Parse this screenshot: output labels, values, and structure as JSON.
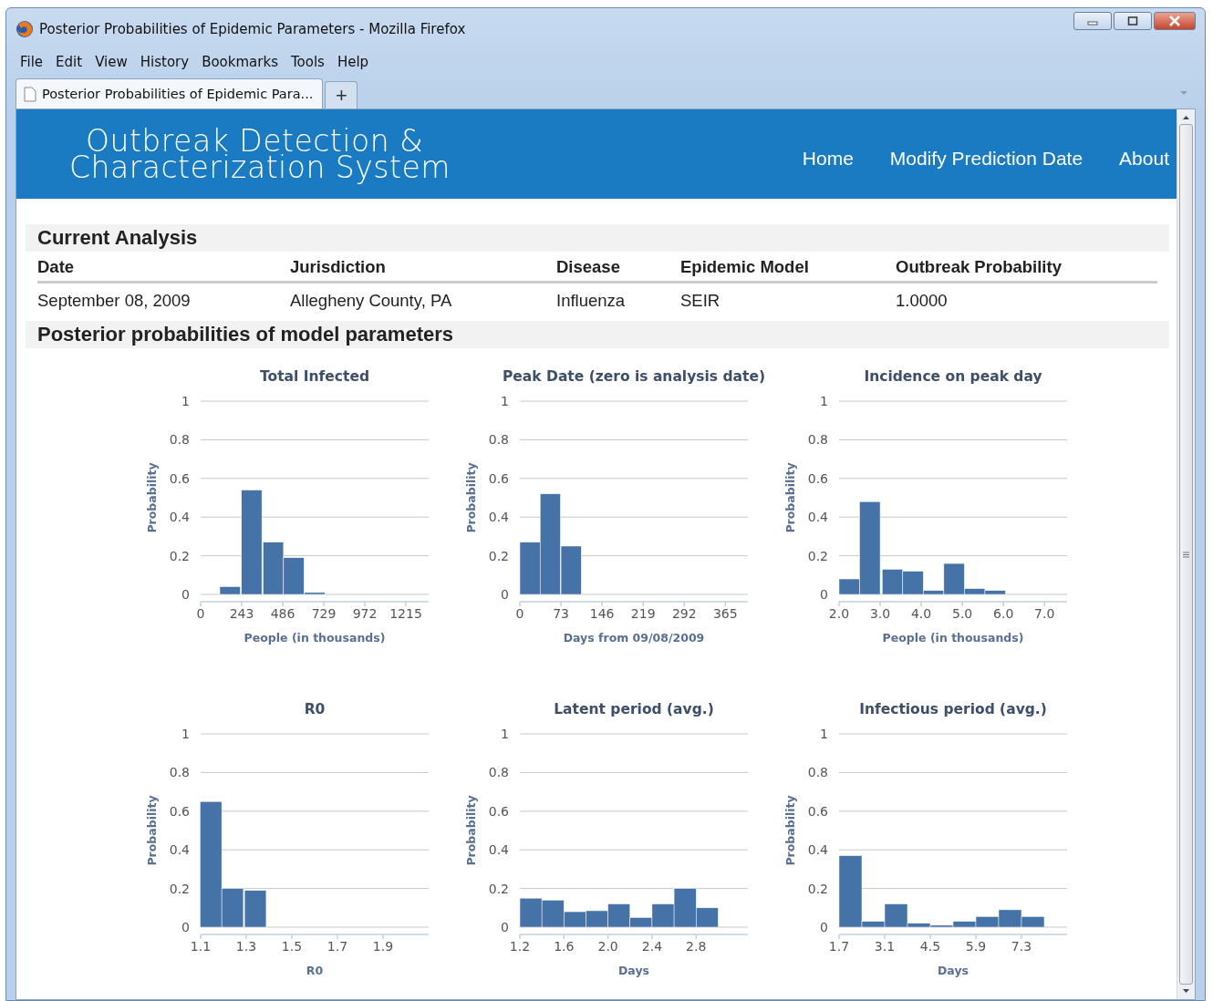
{
  "window": {
    "title": "Posterior Probabilities of Epidemic Parameters - Mozilla Firefox"
  },
  "menu": [
    "File",
    "Edit",
    "View",
    "History",
    "Bookmarks",
    "Tools",
    "Help"
  ],
  "tabs": [
    {
      "label": "Posterior Probabilities of Epidemic Para...",
      "selected": true
    }
  ],
  "new_tab": "+",
  "header": {
    "title_lines": [
      "Outbreak Detection &",
      "Characterization System"
    ],
    "nav": [
      "Home",
      "Modify Prediction Date",
      "About"
    ]
  },
  "analysis": {
    "heading": "Current Analysis",
    "columns": [
      "Date",
      "Jurisdiction",
      "Disease",
      "Epidemic Model",
      "Outbreak Probability"
    ],
    "row": [
      "September 08, 2009",
      "Allegheny County, PA",
      "Influenza",
      "SEIR",
      "1.0000"
    ]
  },
  "posterior": {
    "heading": "Posterior probabilities of model parameters",
    "charts": [
      {
        "chart_data": {
          "type": "bar",
          "title": "Total Infected",
          "xlabel": "People (in thousands)",
          "ylabel": "Probability",
          "x": [
            174,
            302,
            430,
            551,
            675
          ],
          "values": [
            0.04,
            0.54,
            0.27,
            0.19,
            0.01
          ],
          "xlim": [
            0,
            1350
          ],
          "ylim": [
            0,
            1
          ],
          "grid": true,
          "xticks": [
            0,
            243,
            486,
            729,
            972,
            1215
          ],
          "yticks": [
            0,
            0.2,
            0.4,
            0.6,
            0.8,
            1
          ]
        }
      },
      {
        "chart_data": {
          "type": "bar",
          "title": "Peak Date (zero is analysis date)",
          "xlabel": "Days from 09/08/2009",
          "ylabel": "Probability",
          "x": [
            18,
            54,
            91
          ],
          "values": [
            0.27,
            0.52,
            0.25
          ],
          "xlim": [
            0,
            405
          ],
          "ylim": [
            0,
            1
          ],
          "grid": true,
          "xticks": [
            0,
            73,
            146,
            219,
            292,
            365
          ],
          "yticks": [
            0,
            0.2,
            0.4,
            0.6,
            0.8,
            1
          ]
        }
      },
      {
        "chart_data": {
          "type": "bar",
          "title": "Incidence on peak day",
          "xlabel": "People (in thousands)",
          "ylabel": "Probability",
          "x": [
            2.25,
            2.75,
            3.3,
            3.8,
            4.3,
            4.8,
            5.3,
            5.8
          ],
          "values": [
            0.08,
            0.48,
            0.13,
            0.12,
            0.02,
            0.16,
            0.03,
            0.02
          ],
          "xlim": [
            2,
            7.55
          ],
          "ylim": [
            0,
            1
          ],
          "grid": true,
          "xticks": [
            {
              "value": 2,
              "label": "2.0"
            },
            {
              "value": 3,
              "label": "3.0"
            },
            {
              "value": 4,
              "label": "4.0"
            },
            {
              "value": 5,
              "label": "5.0"
            },
            {
              "value": 6,
              "label": "6.0"
            },
            {
              "value": 7,
              "label": "7.0"
            }
          ],
          "yticks": [
            0,
            0.2,
            0.4,
            0.6,
            0.8,
            1
          ]
        }
      },
      {
        "chart_data": {
          "type": "bar",
          "title": "R0",
          "xlabel": "R0",
          "ylabel": "Probability",
          "x": [
            1.145,
            1.24,
            1.34
          ],
          "values": [
            0.65,
            0.2,
            0.19
          ],
          "xlim": [
            1.1,
            2.1
          ],
          "ylim": [
            0,
            1
          ],
          "grid": true,
          "xticks": [
            1.1,
            1.3,
            1.5,
            1.7,
            1.9
          ],
          "yticks": [
            0,
            0.2,
            0.4,
            0.6,
            0.8,
            1
          ]
        }
      },
      {
        "chart_data": {
          "type": "bar",
          "title": "Latent period (avg.)",
          "xlabel": "Days",
          "ylabel": "Probability",
          "x": [
            1.3,
            1.5,
            1.7,
            1.9,
            2.1,
            2.3,
            2.5,
            2.7,
            2.9
          ],
          "values": [
            0.15,
            0.14,
            0.08,
            0.085,
            0.12,
            0.05,
            0.12,
            0.2,
            0.1
          ],
          "xlim": [
            1.2,
            3.27
          ],
          "ylim": [
            0,
            1
          ],
          "grid": true,
          "xticks": [
            1.2,
            1.6,
            {
              "value": 2,
              "label": "2.0"
            },
            2.4,
            2.8
          ],
          "yticks": [
            0,
            0.2,
            0.4,
            0.6,
            0.8,
            1
          ]
        }
      },
      {
        "chart_data": {
          "type": "bar",
          "title": "Infectious period (avg.)",
          "xlabel": "Days",
          "ylabel": "Probability",
          "x": [
            2.05,
            2.75,
            3.45,
            4.15,
            4.85,
            5.55,
            6.25,
            6.95,
            7.65
          ],
          "values": [
            0.37,
            0.03,
            0.12,
            0.02,
            0.01,
            0.03,
            0.055,
            0.09,
            0.055
          ],
          "xlim": [
            1.7,
            8.7
          ],
          "ylim": [
            0,
            1
          ],
          "grid": true,
          "xticks": [
            1.7,
            3.1,
            4.5,
            5.9,
            7.3
          ],
          "yticks": [
            0,
            0.2,
            0.4,
            0.6,
            0.8,
            1
          ]
        }
      }
    ]
  }
}
